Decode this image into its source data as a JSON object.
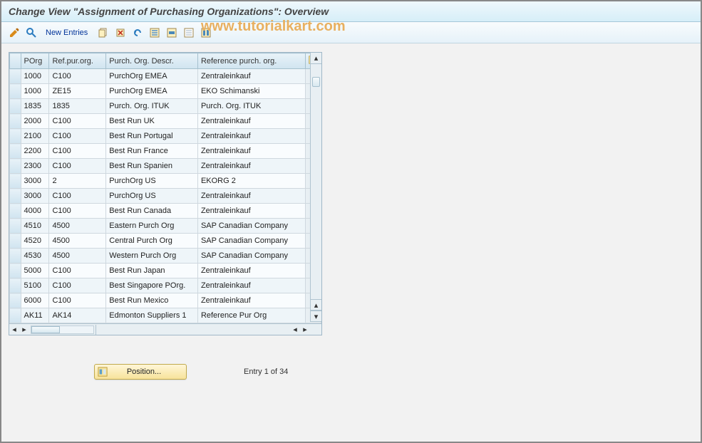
{
  "title": "Change View \"Assignment of Purchasing Organizations\": Overview",
  "watermark": "www.tutorialkart.com",
  "toolbar": {
    "new_entries": "New Entries"
  },
  "table": {
    "columns": {
      "porg": "POrg",
      "refpur": "Ref.pur.org.",
      "descr": "Purch. Org. Descr.",
      "refdesc": "Reference purch. org."
    },
    "rows": [
      {
        "porg": "1000",
        "refpur": "C100",
        "descr": "PurchOrg EMEA",
        "refdesc": "Zentraleinkauf"
      },
      {
        "porg": "1000",
        "refpur": "ZE15",
        "descr": "PurchOrg EMEA",
        "refdesc": "EKO Schimanski"
      },
      {
        "porg": "1835",
        "refpur": "1835",
        "descr": "Purch. Org. ITUK",
        "refdesc": "Purch. Org. ITUK"
      },
      {
        "porg": "2000",
        "refpur": "C100",
        "descr": "Best Run UK",
        "refdesc": "Zentraleinkauf"
      },
      {
        "porg": "2100",
        "refpur": "C100",
        "descr": "Best Run Portugal",
        "refdesc": "Zentraleinkauf"
      },
      {
        "porg": "2200",
        "refpur": "C100",
        "descr": "Best Run France",
        "refdesc": "Zentraleinkauf"
      },
      {
        "porg": "2300",
        "refpur": "C100",
        "descr": "Best Run Spanien",
        "refdesc": "Zentraleinkauf"
      },
      {
        "porg": "3000",
        "refpur": "2",
        "descr": "PurchOrg US",
        "refdesc": "EKORG 2"
      },
      {
        "porg": "3000",
        "refpur": "C100",
        "descr": "PurchOrg US",
        "refdesc": "Zentraleinkauf"
      },
      {
        "porg": "4000",
        "refpur": "C100",
        "descr": "Best Run Canada",
        "refdesc": "Zentraleinkauf"
      },
      {
        "porg": "4510",
        "refpur": "4500",
        "descr": "Eastern Purch Org",
        "refdesc": "SAP Canadian Company"
      },
      {
        "porg": "4520",
        "refpur": "4500",
        "descr": "Central Purch Org",
        "refdesc": "SAP Canadian Company"
      },
      {
        "porg": "4530",
        "refpur": "4500",
        "descr": "Western Purch Org",
        "refdesc": "SAP Canadian Company"
      },
      {
        "porg": "5000",
        "refpur": "C100",
        "descr": "Best Run Japan",
        "refdesc": "Zentraleinkauf"
      },
      {
        "porg": "5100",
        "refpur": "C100",
        "descr": "Best Singapore POrg.",
        "refdesc": "Zentraleinkauf"
      },
      {
        "porg": "6000",
        "refpur": "C100",
        "descr": "Best Run Mexico",
        "refdesc": "Zentraleinkauf"
      },
      {
        "porg": "AK11",
        "refpur": "AK14",
        "descr": "Edmonton Suppliers 1",
        "refdesc": "Reference Pur Org"
      }
    ]
  },
  "footer": {
    "position": "Position...",
    "entry": "Entry 1 of 34"
  }
}
